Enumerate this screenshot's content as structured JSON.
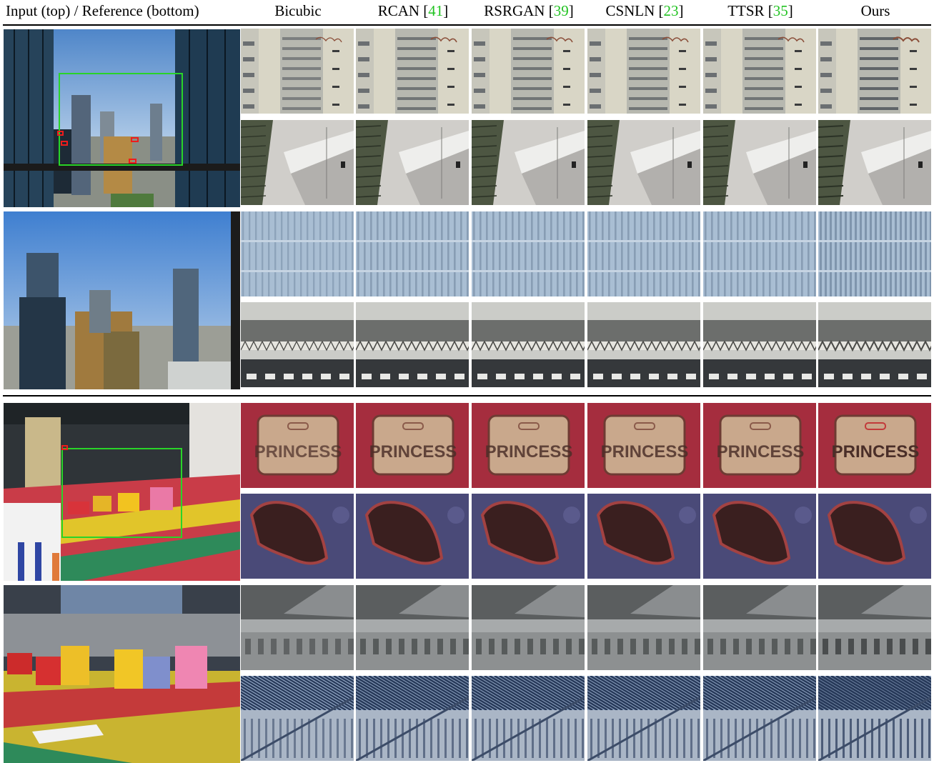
{
  "columns": {
    "input_ref": "Input (top) / Reference (bottom)",
    "bicubic": "Bicubic",
    "rcan": {
      "name": "RCAN [",
      "ref": "41",
      "close": "]"
    },
    "rsrgan": {
      "name": "RSRGAN [",
      "ref": "39",
      "close": "]"
    },
    "csnln": {
      "name": "CSNLN [",
      "ref": "23",
      "close": "]"
    },
    "ttsr": {
      "name": "TTSR [",
      "ref": "35",
      "close": "]"
    },
    "ours": "Ours"
  },
  "crops": {
    "princess_plate_text": "PRINCESS"
  },
  "colors": {
    "citation": "#22c322",
    "bbox_green": "#29d429",
    "bbox_red": "#ee1c1c"
  }
}
